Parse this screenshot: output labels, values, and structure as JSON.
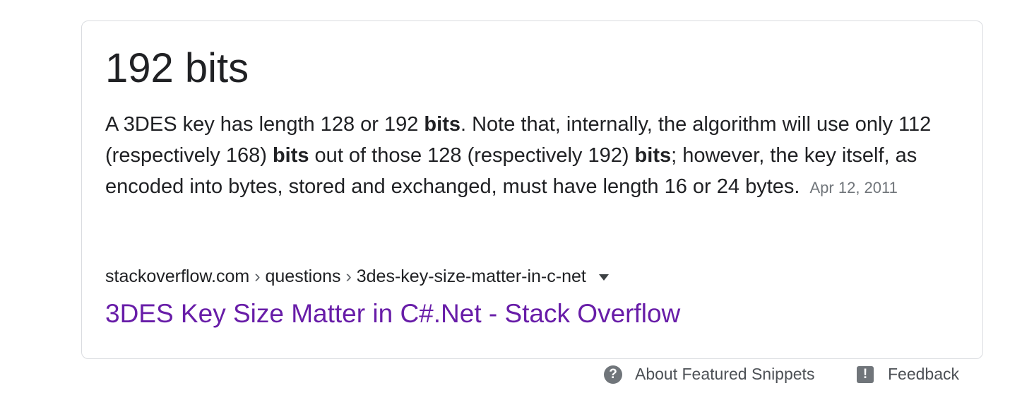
{
  "featured_snippet": {
    "answer": "192 bits",
    "snippet_parts": [
      {
        "text": "A 3DES key has length 128 or 192 ",
        "bold": false
      },
      {
        "text": "bits",
        "bold": true
      },
      {
        "text": ". Note that, internally, the algorithm will use only 112 (respectively 168) ",
        "bold": false
      },
      {
        "text": "bits",
        "bold": true
      },
      {
        "text": " out of those 128 (respectively 192) ",
        "bold": false
      },
      {
        "text": "bits",
        "bold": true
      },
      {
        "text": "; however, the key itself, as encoded into bytes, stored and exchanged, must have length 16 or 24 bytes.",
        "bold": false
      }
    ],
    "date": "Apr 12, 2011",
    "breadcrumb": {
      "domain": "stackoverflow.com",
      "separator": "›",
      "path": [
        "questions",
        "3des-key-size-matter-in-c-net"
      ]
    },
    "result_title": "3DES Key Size Matter in C#.Net - Stack Overflow"
  },
  "footer": {
    "about_label": "About Featured Snippets",
    "feedback_label": "Feedback",
    "about_icon": "help-circle-icon",
    "feedback_icon": "feedback-icon"
  },
  "colors": {
    "link_visited": "#681da8",
    "text": "#202124",
    "muted": "#70757a",
    "border": "#dadce0"
  }
}
